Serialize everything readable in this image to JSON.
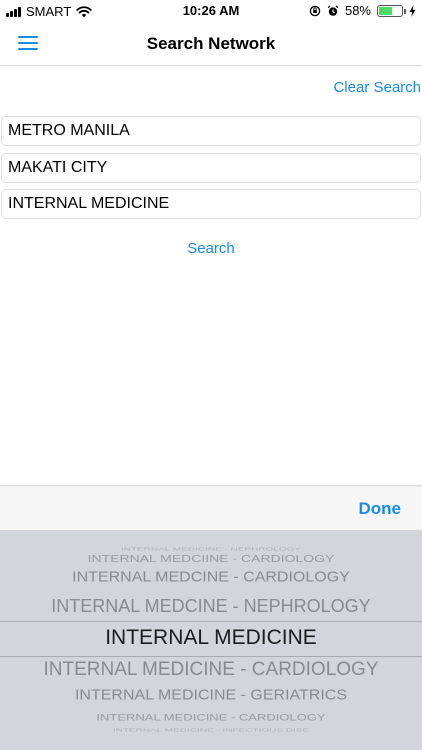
{
  "status_bar": {
    "carrier": "SMART",
    "time": "10:26 AM",
    "battery_percent": "58%",
    "battery_level": 0.58,
    "icons": [
      "signal-icon",
      "wifi-icon",
      "orientation-lock-icon",
      "alarm-icon",
      "battery-icon",
      "charging-icon"
    ]
  },
  "nav": {
    "title": "Search Network",
    "menu_icon": "hamburger-menu-icon"
  },
  "form": {
    "clear_label": "Clear Search",
    "fields": [
      {
        "value": "METRO MANILA"
      },
      {
        "value": "MAKATI CITY"
      },
      {
        "value": "INTERNAL MEDICINE"
      }
    ],
    "search_label": "Search"
  },
  "picker": {
    "done_label": "Done",
    "rows": [
      "INTERNAL MEDICINE - NEPHROLOGY",
      "INTERNAL MEDCIINE - CARDIOLOGY",
      "INTERNAL MEDCINE - CARDIOLOGY",
      "INTERNAL MEDCINE - NEPHROLOGY",
      "INTERNAL MEDICINE",
      "INTERNAL MEDICINE  - CARDIOLOGY",
      "INTERNAL MEDICINE  - GERIATRICS",
      "INTERNAL MEDICINE  - CARDIOLOGY",
      "INTERNAL MEDICINE - INFECTIOUS DISE"
    ],
    "selected": "INTERNAL MEDICINE"
  },
  "colors": {
    "accent": "#1a8ce8",
    "picker_bg": "#d2d5db",
    "battery": "#4cd964"
  }
}
